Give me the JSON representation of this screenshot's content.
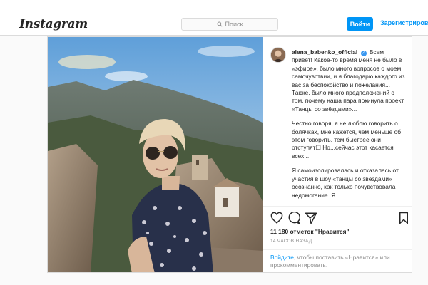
{
  "header": {
    "logo": "Instagram",
    "search_placeholder": "Поиск",
    "login_label": "Войти",
    "signup_label": "Зарегистрироваться"
  },
  "post": {
    "username": "alena_babenko_official",
    "caption_paragraphs": [
      "Всем привет! Какое-то время меня не было в «эфире», было много вопросов о моем самочувствии, и я благодарю каждого из вас за беспокойство и пожелания... Также, было много предположений о том, почему наша пара покинула проект «Танцы со звёздами»...",
      "Честно говоря, я не люблю говорить о болячках, мне кажется, чем меньше об этом говорить, тем быстрее они отступят☐ Но...сейчас этот касается всех...",
      "Я самоизолировалась и отказалась от участия в шоу «танцы со звёздами» осознанно, как только почувствовала недомогание. Я"
    ],
    "likes": "11 180 отметок \"Нравится\"",
    "timestamp": "14 ЧАСОВ НАЗАД",
    "login_link": "Войдите",
    "login_text": ", чтобы поставить «Нравится» или прокомментировать.",
    "icons": [
      "heart-icon",
      "comment-icon",
      "share-icon",
      "save-icon"
    ]
  },
  "colors": {
    "accent": "#0095f6",
    "verified": "#3897f0",
    "border": "#dbdbdb"
  }
}
